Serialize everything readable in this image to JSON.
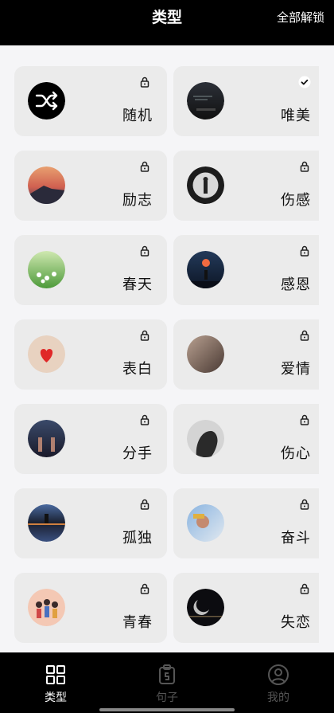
{
  "header": {
    "title": "类型",
    "unlock_all_label": "全部解锁"
  },
  "categories": [
    {
      "label": "随机",
      "status": "locked",
      "icon": "shuffle-icon"
    },
    {
      "label": "唯美",
      "status": "selected",
      "icon": "photo-avatar"
    },
    {
      "label": "励志",
      "status": "locked",
      "icon": "photo-avatar"
    },
    {
      "label": "伤感",
      "status": "locked",
      "icon": "photo-avatar"
    },
    {
      "label": "春天",
      "status": "locked",
      "icon": "photo-avatar"
    },
    {
      "label": "感恩",
      "status": "locked",
      "icon": "photo-avatar"
    },
    {
      "label": "表白",
      "status": "locked",
      "icon": "photo-avatar"
    },
    {
      "label": "爱情",
      "status": "locked",
      "icon": "photo-avatar"
    },
    {
      "label": "分手",
      "status": "locked",
      "icon": "photo-avatar"
    },
    {
      "label": "伤心",
      "status": "locked",
      "icon": "photo-avatar"
    },
    {
      "label": "孤独",
      "status": "locked",
      "icon": "photo-avatar"
    },
    {
      "label": "奋斗",
      "status": "locked",
      "icon": "photo-avatar"
    },
    {
      "label": "青春",
      "status": "locked",
      "icon": "photo-avatar"
    },
    {
      "label": "失恋",
      "status": "locked",
      "icon": "photo-avatar"
    }
  ],
  "tabbar": {
    "tabs": [
      {
        "label": "类型",
        "icon": "grid-icon",
        "active": true
      },
      {
        "label": "句子",
        "icon": "clipboard-icon",
        "active": false
      },
      {
        "label": "我的",
        "icon": "user-icon",
        "active": false
      }
    ]
  },
  "colors": {
    "topbar_bg": "#000000",
    "page_bg": "#f5f5f7",
    "card_bg": "#ebebeb",
    "tab_active": "#ffffff",
    "tab_inactive": "#555555"
  }
}
